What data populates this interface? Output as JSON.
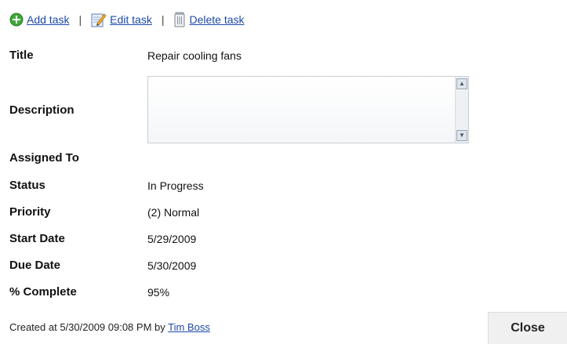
{
  "toolbar": {
    "add_label": "Add task",
    "edit_label": "Edit task",
    "delete_label": "Delete task",
    "separator": "|",
    "icons": {
      "add": "add-circle-icon",
      "edit": "pencil-edit-icon",
      "delete": "trash-icon"
    },
    "add_icon_color": "#3fa83a"
  },
  "fields": {
    "title": {
      "label": "Title",
      "value": "Repair cooling fans"
    },
    "description": {
      "label": "Description",
      "value": ""
    },
    "assigned_to": {
      "label": "Assigned To",
      "value": ""
    },
    "status": {
      "label": "Status",
      "value": "In Progress"
    },
    "priority": {
      "label": "Priority",
      "value": "(2) Normal"
    },
    "start_date": {
      "label": "Start Date",
      "value": "5/29/2009"
    },
    "due_date": {
      "label": "Due Date",
      "value": "5/30/2009"
    },
    "percent_complete": {
      "label": "% Complete",
      "value": "95%"
    }
  },
  "footer": {
    "created_prefix": "Created at 5/30/2009 09:08 PM by",
    "created_by": "Tim Boss",
    "close_label": "Close"
  },
  "colors": {
    "link": "#1c4aa6",
    "close_bg": "#f0f0f0"
  }
}
